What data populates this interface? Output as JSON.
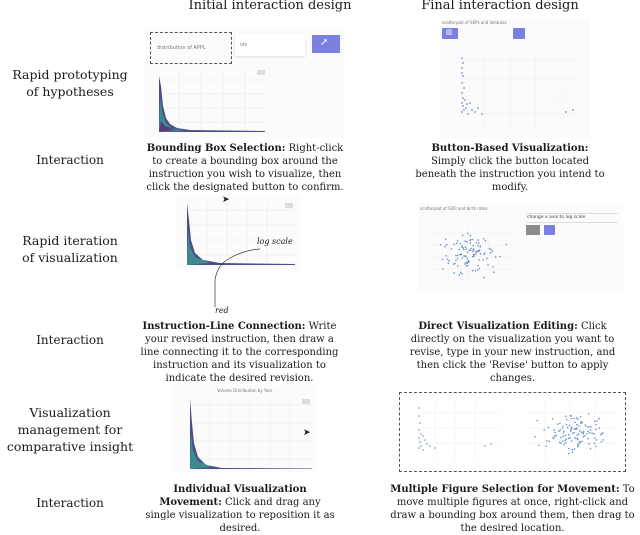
{
  "columns": {
    "initial": "Initial interaction design",
    "final": "Final interaction design"
  },
  "rows": [
    {
      "label": "Rapid prototyping\nof hypotheses",
      "interaction_label": "Interaction",
      "initial": {
        "title": "Bounding Box Selection:",
        "text": " Right-click to create a bounding box around the instruction you wish to visualize, then click the designated button to confirm.",
        "instruction_text": "distribution of APPL",
        "input_text": "vis",
        "button_icon": "rocket-icon"
      },
      "final": {
        "title": "Button-Based Visualization:",
        "text": " Simply click the button located beneath the instruction you intend to modify.",
        "instruction_text": "scatterplot of SEPs and lambdas",
        "button_icon": "chart-icon"
      }
    },
    {
      "label": "Rapid iteration\nof visualization",
      "interaction_label": "Interaction",
      "initial": {
        "title": "Instruction-Line Connection:",
        "text": " Write your revised instruction, then draw a line connecting it to the corresponding instruction and its visualization to indicate the desired revision.",
        "annotation_top": "log scale",
        "annotation_bottom": "red"
      },
      "final": {
        "title": "Direct Visualization Editing:",
        "text": " Click directly on the visualization you want to revise, type in your new instruction, and then click the 'Revise' button to apply changes.",
        "instruction_text": "scatterplot of GDP and birth rates",
        "edit_text": "change x axis to log scale"
      }
    },
    {
      "label": "Visualization\nmanagement for\ncomparative insight",
      "interaction_label": "Interaction",
      "initial": {
        "title": "Individual Visualization Movement:",
        "text": " Click and drag any single visualization to reposition it as desired.",
        "chart_title": "Volume Distribution by Year"
      },
      "final": {
        "title": "Multiple Figure Selection for Movement:",
        "text": " To move multiple figures at once, right-click and draw a bounding box around them, then drag to the desired location."
      }
    }
  ]
}
